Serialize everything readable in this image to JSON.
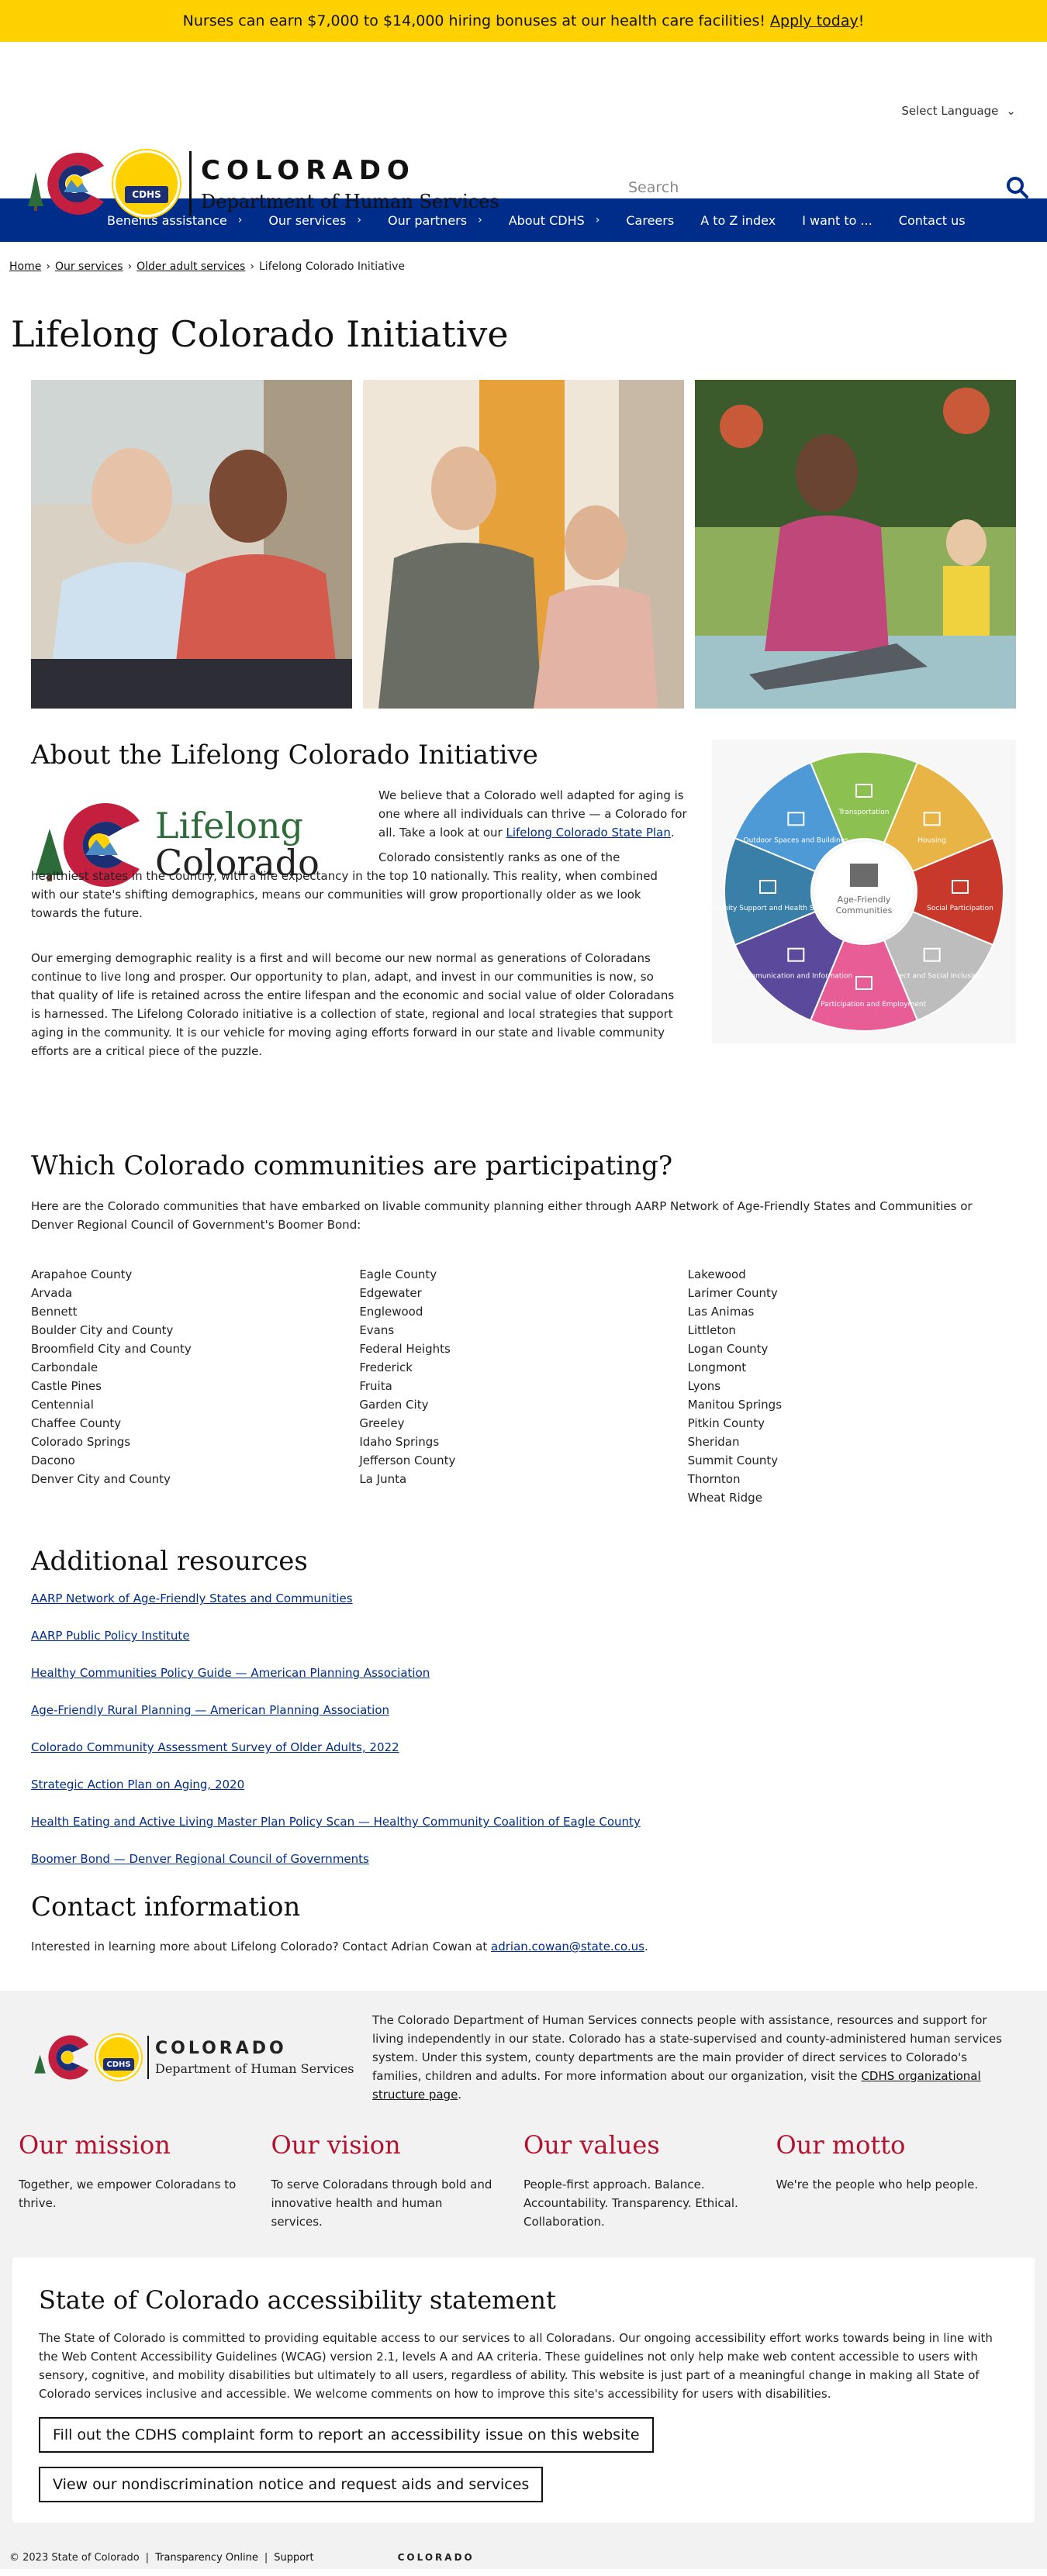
{
  "banner": {
    "text": "Nurses can earn $7,000 to $14,000 hiring bonuses at our health care facilities!",
    "link": "Apply today",
    "tail": "!"
  },
  "header": {
    "language": "Select Language",
    "brand_line1": "COLORADO",
    "brand_line2": "Department of Human Services",
    "badge": "CDHS",
    "search_placeholder": "Search"
  },
  "nav": [
    {
      "label": "Benefits assistance",
      "chevron": true
    },
    {
      "label": "Our services",
      "chevron": true
    },
    {
      "label": "Our partners",
      "chevron": true
    },
    {
      "label": "About CDHS",
      "chevron": true
    },
    {
      "label": "Careers",
      "chevron": false
    },
    {
      "label": "A to Z index",
      "chevron": false
    },
    {
      "label": "I want to ...",
      "chevron": false
    },
    {
      "label": "Contact us",
      "chevron": false
    }
  ],
  "breadcrumb": {
    "home": "Home",
    "services": "Our services",
    "older": "Older adult services",
    "current": "Lifelong Colorado Initiative"
  },
  "page_title": "Lifelong Colorado Initiative",
  "about": {
    "heading": "About the Lifelong Colorado Initiative",
    "logo_l1": "Lifelong",
    "logo_l2": "Colorado",
    "p1_a": "We believe that a Colorado well adapted for aging is one where all individuals can thrive — a Colorado for all. Take a look at our ",
    "p1_link": "Lifelong Colorado State Plan",
    "p1_b": ".",
    "p2": "Colorado consistently ranks as one of the healthiest states in the country, with a life expectancy in the top 10 nationally. This reality, when combined with our state's shifting demographics, means our communities will grow proportionally older as we look towards the future.",
    "p3": "Our emerging demographic reality is a first and will become our new normal as generations of Coloradans continue to live long and prosper. Our opportunity to plan, adapt, and invest in our communities is now, so that quality of life is retained across the entire lifespan and the economic and social value of older Coloradans is harnessed. The Lifelong Colorado initiative is a collection of state, regional and local strategies that support aging in the community. It is our vehicle for moving aging efforts forward in our state and livable community efforts are a critical piece of the puzzle.",
    "wheel_center": [
      "Age-Friendly",
      "Communities"
    ],
    "wheel_segments": [
      {
        "label": "Transportation",
        "color": "#8cc152"
      },
      {
        "label": "Housing",
        "color": "#e8b446"
      },
      {
        "label": "Social Participation",
        "color": "#c9392b"
      },
      {
        "label": "Respect and Social Inclusion",
        "color": "#bdbdbd"
      },
      {
        "label": "Civic Participation and Employment",
        "color": "#e95d97"
      },
      {
        "label": "Communication and Information",
        "color": "#5b4a9b"
      },
      {
        "label": "Community Support and Health Services",
        "color": "#3a7fa8"
      },
      {
        "label": "Outdoor Spaces and Buildings",
        "color": "#4e9ad6"
      }
    ]
  },
  "communities": {
    "heading": "Which Colorado communities are participating?",
    "intro": "Here are the Colorado communities that have embarked on livable community planning either through AARP Network of Age-Friendly States and Communities or Denver Regional Council of Government's Boomer Bond:",
    "col1": [
      "Arapahoe County",
      "Arvada",
      "Bennett",
      "Boulder City and County",
      "Broomfield City and County",
      "Carbondale",
      "Castle Pines",
      "Centennial",
      "Chaffee County",
      "Colorado Springs",
      "Dacono",
      "Denver City and County"
    ],
    "col2": [
      "Eagle County",
      "Edgewater",
      "Englewood",
      "Evans",
      "Federal Heights",
      "Frederick",
      "Fruita",
      "Garden City",
      "Greeley",
      "Idaho Springs",
      "Jefferson County",
      "La Junta"
    ],
    "col3": [
      "Lakewood",
      "Larimer County",
      "Las Animas",
      "Littleton",
      "Logan County",
      "Longmont",
      "Lyons",
      "Manitou Springs",
      "Pitkin County",
      "Sheridan",
      "Summit County",
      "Thornton",
      "Wheat Ridge"
    ]
  },
  "resources": {
    "heading": "Additional resources",
    "links": [
      "AARP Network of Age-Friendly States and Communities",
      "AARP Public Policy Institute",
      "Healthy Communities Policy Guide — American Planning Association",
      "Age-Friendly Rural Planning — American Planning Association",
      "Colorado Community Assessment Survey of Older Adults, 2022",
      "Strategic Action Plan on Aging, 2020",
      "Health Eating and Active Living Master Plan Policy Scan — Healthy Community Coalition of Eagle County",
      "Boomer Bond — Denver Regional Council of Governments"
    ]
  },
  "contact": {
    "heading": "Contact information",
    "text": "Interested in learning more about Lifelong Colorado? Contact Adrian Cowan at ",
    "email": "adrian.cowan@state.co.us",
    "tail": "."
  },
  "footer": {
    "brand_line1": "COLORADO",
    "brand_line2": "Department of Human Services",
    "badge": "CDHS",
    "about": "The Colorado Department of Human Services connects people with assistance, resources and support for living independently in our state. Colorado has a state-supervised and county-administered human services system. Under this system, county departments are the main provider of direct services to Colorado's families, children and adults. For more information about our organization, visit the ",
    "about_link": "CDHS organizational structure page",
    "about_tail": ".",
    "mission_h": "Our mission",
    "mission": "Together, we empower Coloradans to thrive.",
    "vision_h": "Our vision",
    "vision": "To serve Coloradans through bold and innovative health and human services.",
    "values_h": "Our values",
    "values": "People-first approach. Balance. Accountability. Transparency. Ethical. Collaboration.",
    "motto_h": "Our motto",
    "motto": "We're the people who help people.",
    "access_h": "State of Colorado accessibility statement",
    "access_p": "The State of Colorado is committed to providing equitable access to our services to all Coloradans. Our ongoing accessibility effort works towards being in line with the Web Content Accessibility Guidelines (WCAG) version 2.1, levels A and AA criteria. These guidelines not only help make web content accessible to users with sensory, cognitive, and mobility disabilities but ultimately to all users, regardless of ability. This website is just part of a meaningful change in making all State of Colorado services inclusive and accessible. We welcome comments on how to improve this site's accessibility for users with disabilities.",
    "btn1": "Fill out the CDHS complaint form to report an accessibility issue on this website",
    "btn2": "View our nondiscrimination notice and request aids and services",
    "copyright": "© 2023 State of Colorado",
    "transparency": "Transparency Online",
    "support": "Support",
    "bottom_logo": "COLORADO"
  }
}
